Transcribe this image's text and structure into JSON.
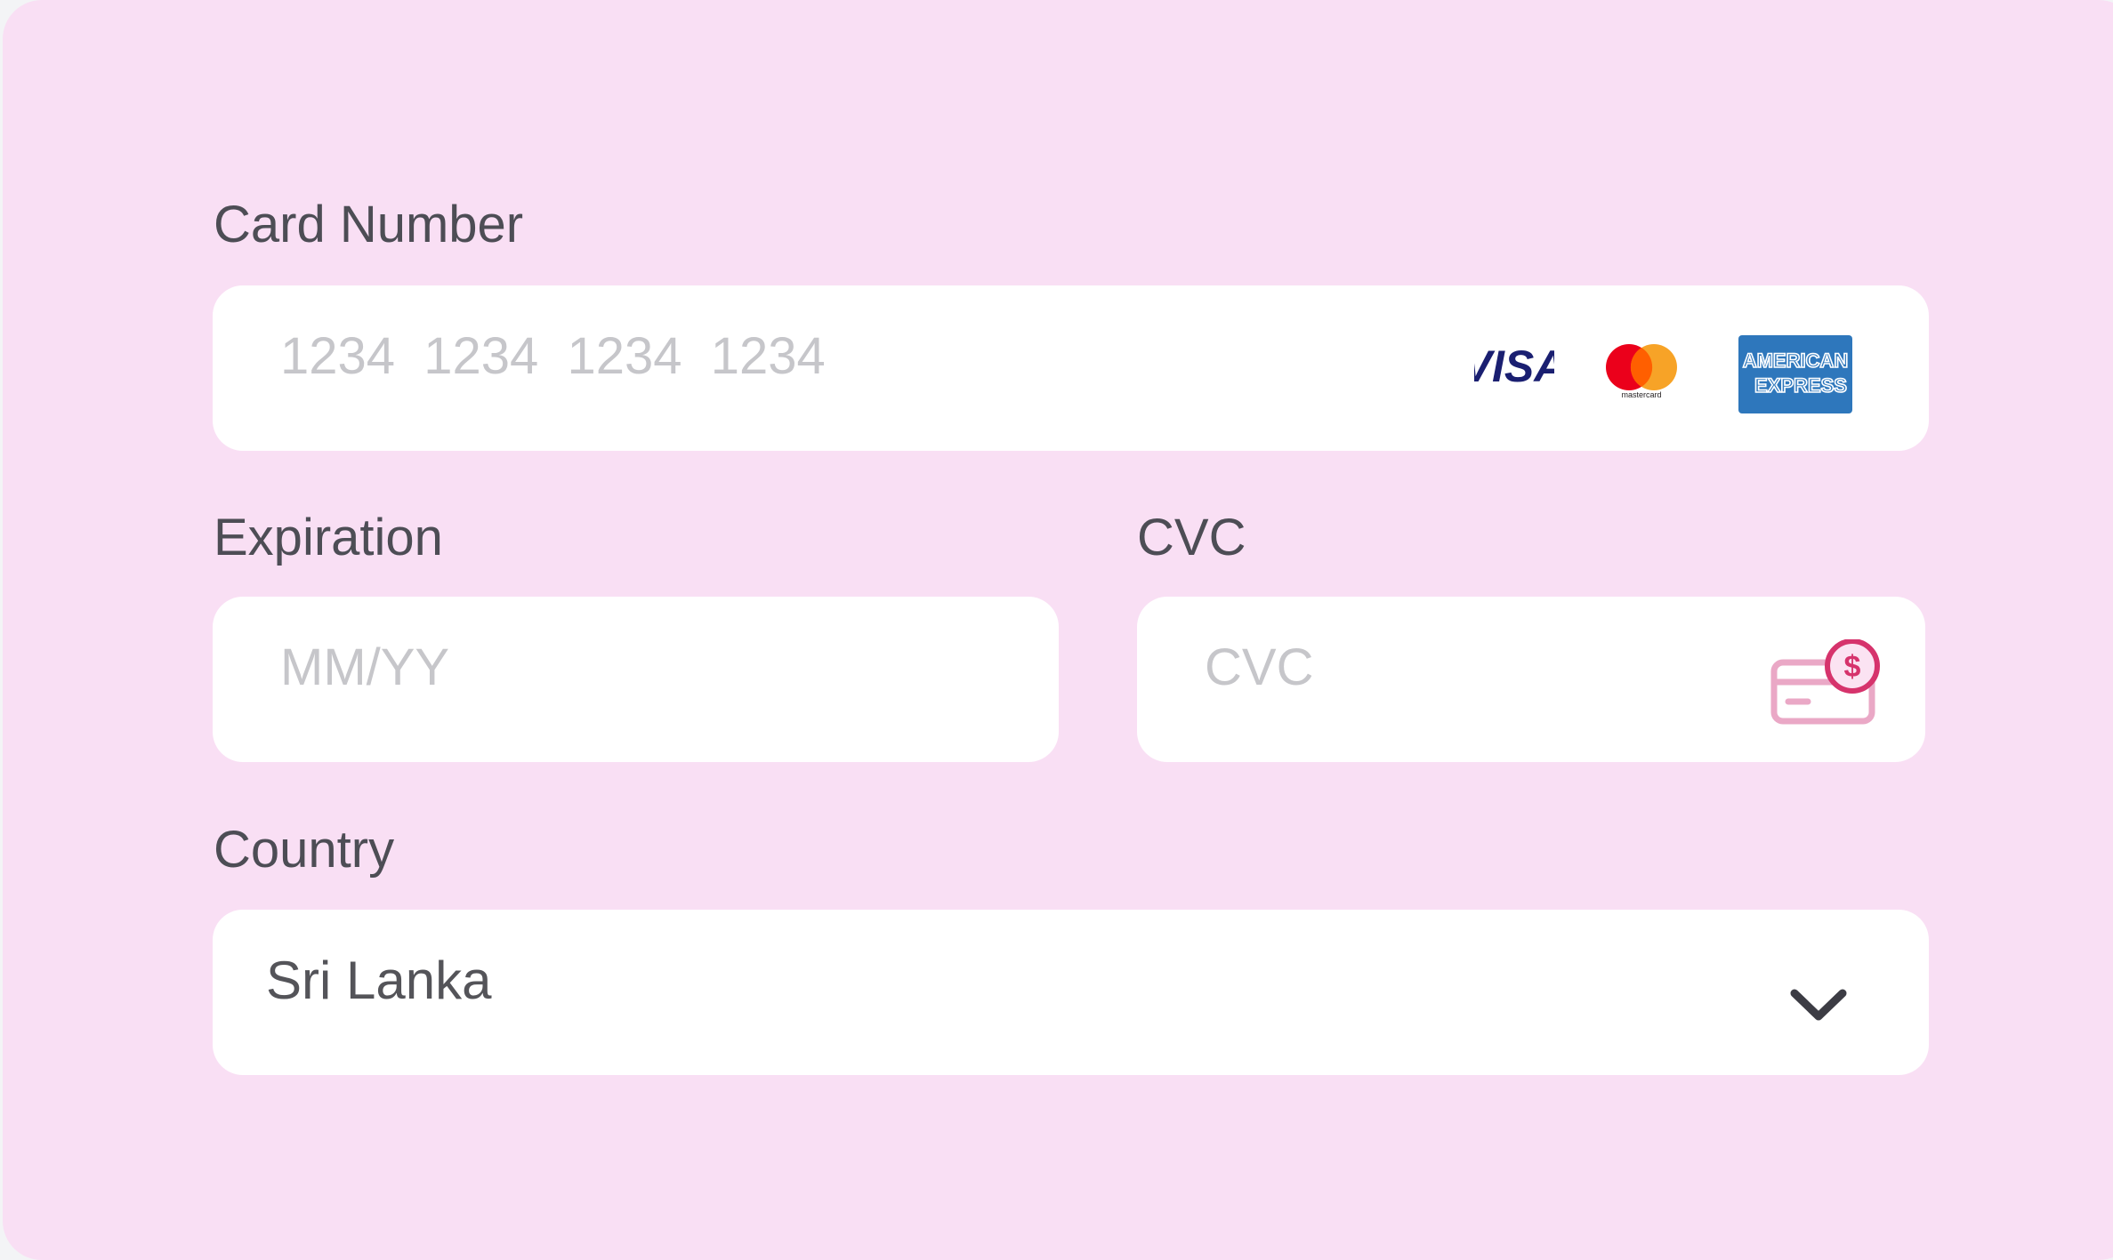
{
  "form": {
    "card_number": {
      "label": "Card Number",
      "placeholder": "1234  1234  1234  1234",
      "brands": [
        {
          "icon": "visa-logo-icon",
          "text": "VISA",
          "color": "#1a1f71"
        },
        {
          "icon": "mastercard-logo-icon",
          "text": "mastercard",
          "colors": [
            "#eb001b",
            "#f79e1b"
          ]
        },
        {
          "icon": "amex-logo-icon",
          "text": "AMERICAN EXPRESS",
          "color": "#2e77bc"
        }
      ]
    },
    "expiration": {
      "label": "Expiration",
      "placeholder": "MM/YY"
    },
    "cvc": {
      "label": "CVC",
      "placeholder": "CVC",
      "icon": "card-cvc-icon",
      "icon_color": "#e7a6c4",
      "badge_color": "#d6336c"
    },
    "country": {
      "label": "Country",
      "selected": "Sri Lanka",
      "icon": "chevron-down-icon"
    }
  },
  "colors": {
    "panel_background": "#f9dff4",
    "field_background": "#ffffff",
    "label_text": "#4d4d55",
    "placeholder_text": "#c6c6ca"
  }
}
